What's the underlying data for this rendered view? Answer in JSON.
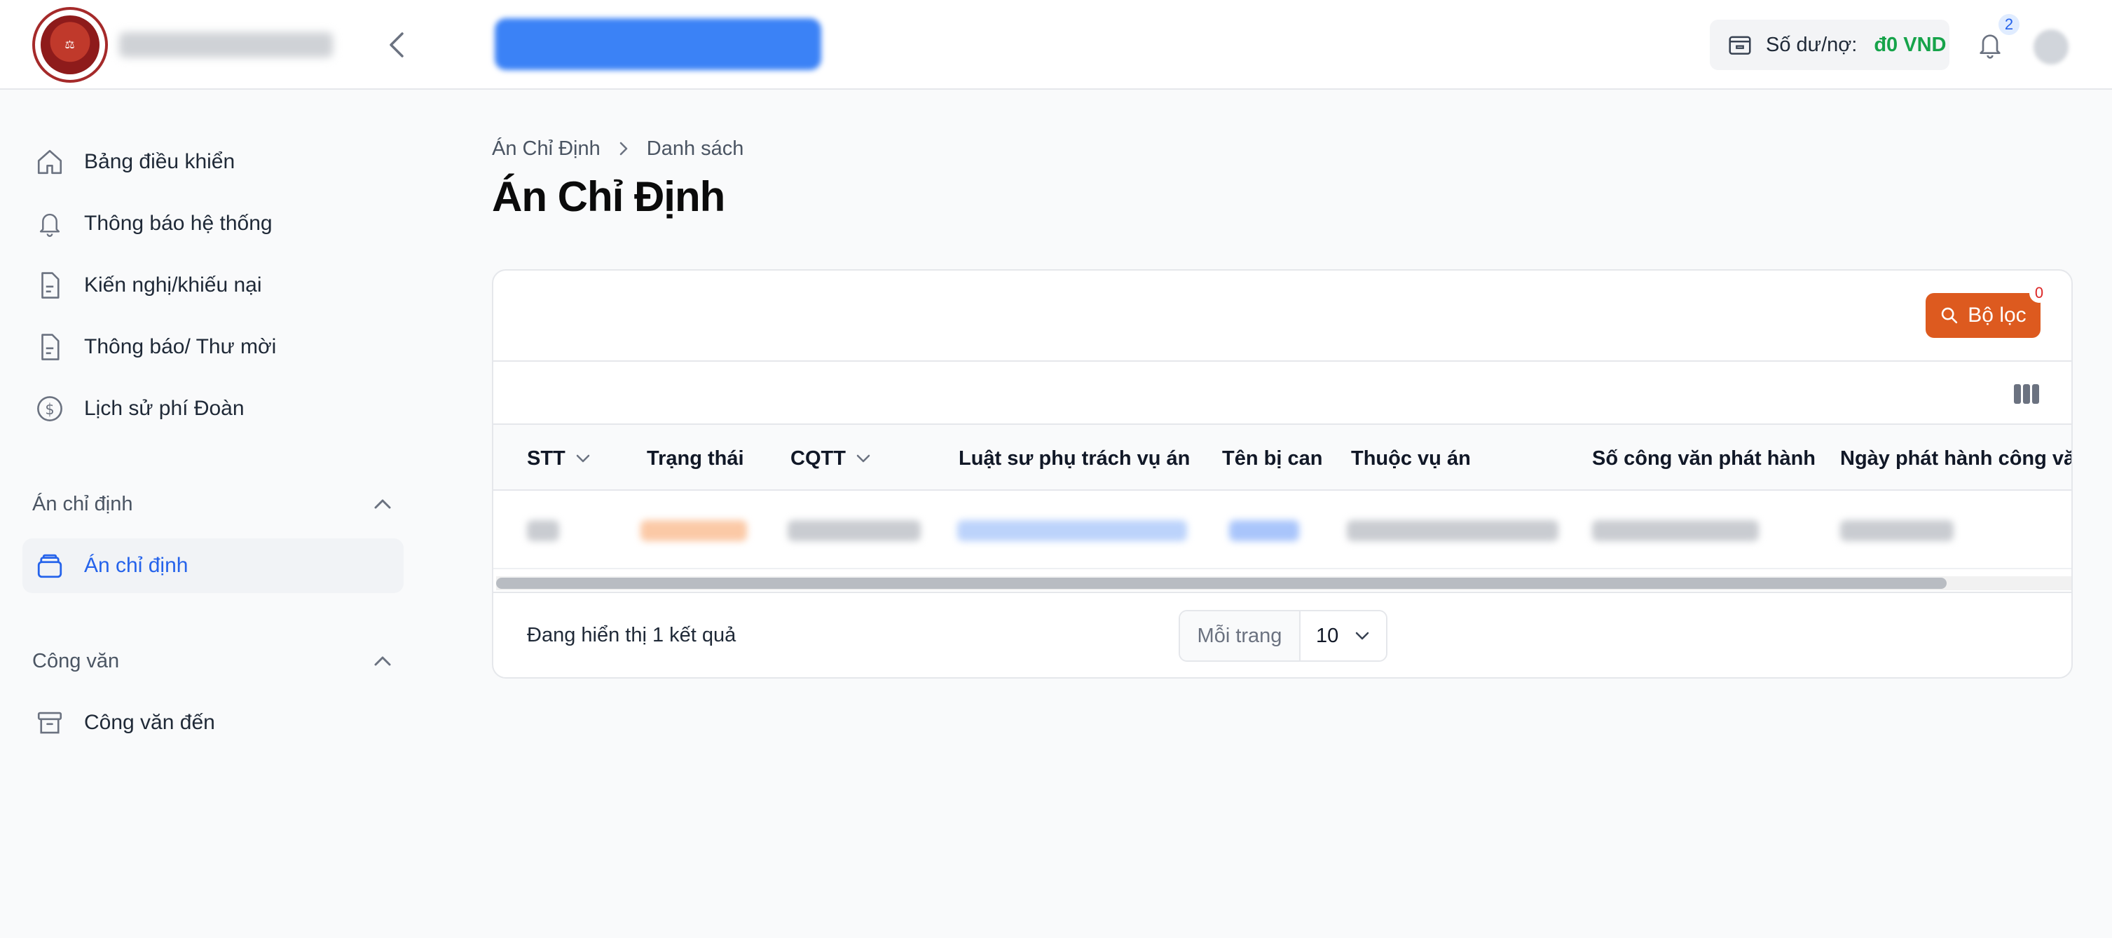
{
  "topbar": {
    "balance_label": "Số dư/nợ:",
    "balance_amount": "đ0 VND",
    "notification_count": "2"
  },
  "sidebar": {
    "items": [
      {
        "label": "Bảng điều khiển",
        "icon": "home-icon"
      },
      {
        "label": "Thông báo hệ thống",
        "icon": "bell-icon"
      },
      {
        "label": "Kiến nghị/khiếu nại",
        "icon": "document-icon"
      },
      {
        "label": "Thông báo/ Thư mời",
        "icon": "document-icon"
      },
      {
        "label": "Lịch sử phí Đoàn",
        "icon": "dollar-circle-icon"
      }
    ],
    "sections": [
      {
        "title": "Án chỉ định",
        "items": [
          {
            "label": "Án chỉ định",
            "icon": "layers-icon",
            "active": true
          }
        ]
      },
      {
        "title": "Công văn",
        "items": [
          {
            "label": "Công văn đến",
            "icon": "archive-icon"
          }
        ]
      }
    ]
  },
  "breadcrumb": {
    "root": "Án Chỉ Định",
    "current": "Danh sách"
  },
  "page_title": "Án Chỉ Định",
  "filter": {
    "label": "Bộ lọc",
    "count": "0"
  },
  "table": {
    "columns": [
      "STT",
      "Trạng thái",
      "CQTT",
      "Luật sư phụ trách vụ án",
      "Tên bị can",
      "Thuộc vụ án",
      "Số công văn phát hành",
      "Ngày phát hành công văn"
    ]
  },
  "footer": {
    "results_text": "Đang hiển thị 1 kết quả",
    "per_page_label": "Mỗi trang",
    "per_page_value": "10"
  },
  "colors": {
    "accent": "#dd5a1f",
    "active_link": "#2563eb",
    "balance_positive": "#16a34a"
  }
}
